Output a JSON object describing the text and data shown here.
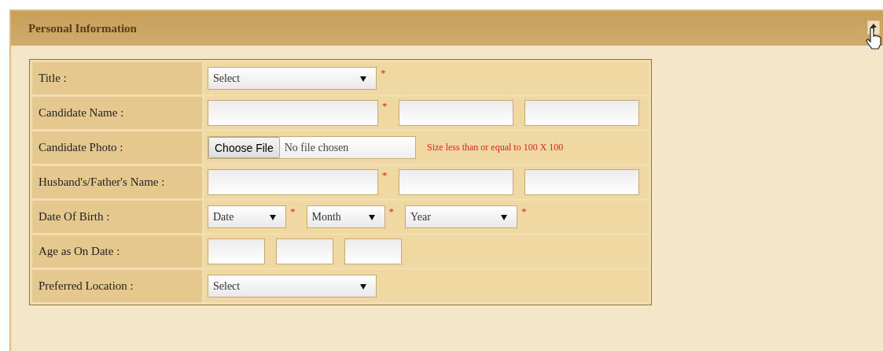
{
  "panel": {
    "title": "Personal Information",
    "collapse_button": {
      "expanded": true
    }
  },
  "rows": [
    {
      "label": "Title :",
      "controls": [
        {
          "kind": "select",
          "value": "Select",
          "mark": "*"
        }
      ]
    },
    {
      "label": "Candidate Name :",
      "controls": [
        {
          "kind": "text",
          "mark": "*"
        },
        {
          "kind": "short-text"
        },
        {
          "kind": "short-text"
        }
      ]
    },
    {
      "label": "Candidate Photo :",
      "controls": [
        {
          "kind": "file",
          "button": "Choose File",
          "status": "No file chosen"
        },
        {
          "kind": "note",
          "text": "Size less than or equal to 100 X 100"
        }
      ]
    },
    {
      "label": "Husband's/Father's Name :",
      "controls": [
        {
          "kind": "text",
          "mark": "*"
        },
        {
          "kind": "short-text"
        },
        {
          "kind": "short-text"
        }
      ]
    },
    {
      "label": "Date Of Birth :",
      "controls": [
        {
          "kind": "short-select",
          "value": "Date",
          "mark": "*"
        },
        {
          "kind": "short-select",
          "value": "Month",
          "mark": "*"
        },
        {
          "kind": "medium-select",
          "value": "Year",
          "mark": "*"
        }
      ]
    },
    {
      "label": "Age as On Date :",
      "controls": [
        {
          "kind": "tiny-text"
        },
        {
          "kind": "tiny-text"
        },
        {
          "kind": "tiny-text"
        }
      ]
    },
    {
      "label": "Preferred Location :",
      "controls": [
        {
          "kind": "select",
          "value": "Select"
        }
      ]
    }
  ]
}
